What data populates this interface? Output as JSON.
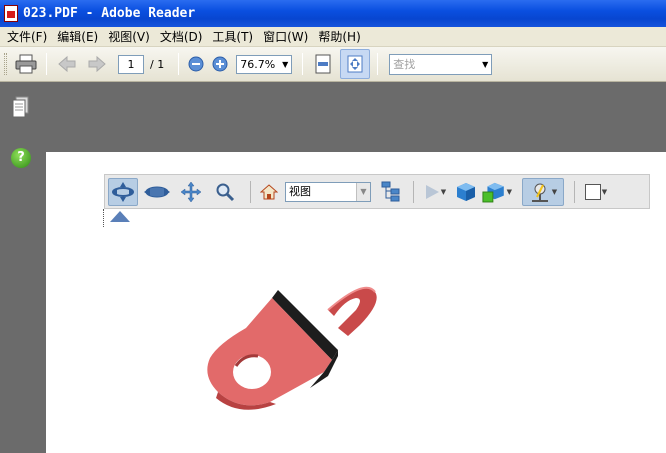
{
  "window": {
    "title": "023.PDF - Adobe Reader"
  },
  "menu": {
    "items": [
      "文件(F)",
      "编辑(E)",
      "视图(V)",
      "文档(D)",
      "工具(T)",
      "窗口(W)",
      "帮助(H)"
    ]
  },
  "toolbar": {
    "current_page": "1",
    "page_total": "/ 1",
    "zoom": "76.7%",
    "find_placeholder": "查找"
  },
  "toolbar3d": {
    "view_select": "视图"
  },
  "icons": {
    "print": "printer-icon",
    "prev": "arrow-left-icon",
    "next": "arrow-right-icon",
    "zoom_out": "zoom-out-icon",
    "zoom_in": "zoom-in-icon",
    "fit_width": "fit-width-icon",
    "fit_page": "fit-page-icon",
    "pages": "pages-icon",
    "help": "help-icon"
  },
  "colors": {
    "titlebar": "#0a4fe0",
    "workspace": "#6b6b6b",
    "model": "#e26a6a"
  }
}
